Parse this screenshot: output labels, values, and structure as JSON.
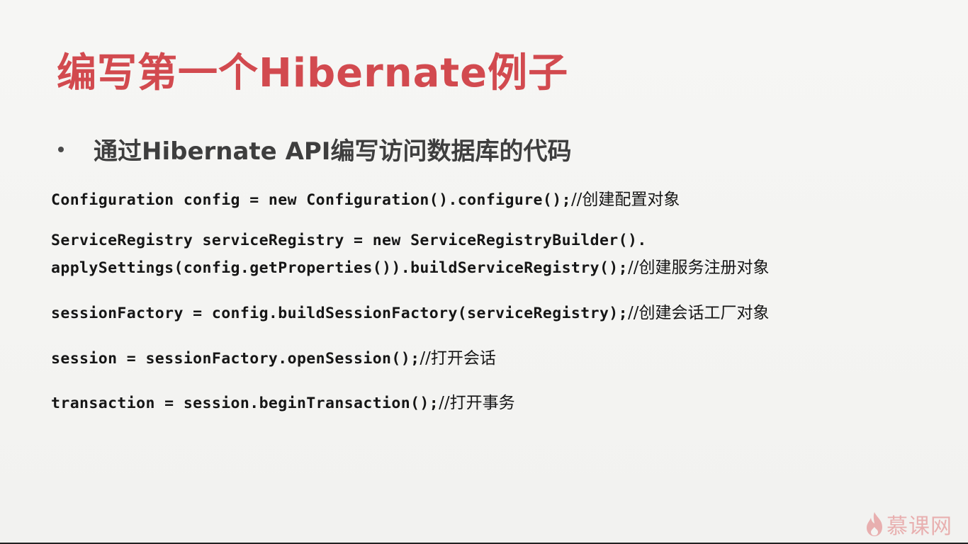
{
  "slide": {
    "title": "编写第一个Hibernate例子",
    "bullet": "通过Hibernate API编写访问数据库的代码",
    "code_lines": [
      {
        "code": "Configuration config = new Configuration().configure();",
        "comment": "//创建配置对象"
      },
      {
        "code": "ServiceRegistry serviceRegistry = new ServiceRegistryBuilder().",
        "comment": ""
      },
      {
        "code": " applySettings(config.getProperties()).buildServiceRegistry();",
        "comment": "//创建服务注册对象"
      },
      {
        "code": "sessionFactory = config.buildSessionFactory(serviceRegistry);",
        "comment": "//创建会话工厂对象"
      },
      {
        "code": "session = sessionFactory.openSession();",
        "comment": "//打开会话"
      },
      {
        "code": "transaction = session.beginTransaction();",
        "comment": "//打开事务"
      }
    ],
    "logo_text": "慕课网",
    "colors": {
      "title": "#d24a4f",
      "bullet_text": "#3e3e3e",
      "code": "#161616",
      "logo": "#e07a7a"
    }
  }
}
